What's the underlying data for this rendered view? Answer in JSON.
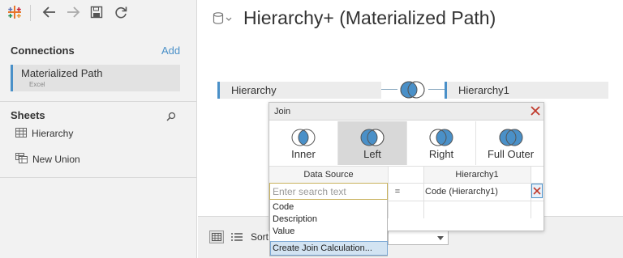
{
  "sidebar": {
    "connections_title": "Connections",
    "add_label": "Add",
    "connection": {
      "name": "Materialized Path",
      "type": "Excel"
    },
    "sheets_title": "Sheets",
    "sheets": [
      {
        "label": "Hierarchy",
        "icon": "table-icon"
      },
      {
        "label": "New Union",
        "icon": "union-icon"
      }
    ]
  },
  "header": {
    "title": "Hierarchy+ (Materialized Path)"
  },
  "canvas": {
    "left_table": "Hierarchy",
    "right_table": "Hierarchy1"
  },
  "join_dialog": {
    "title": "Join",
    "types": [
      {
        "label": "Inner",
        "selected": false
      },
      {
        "label": "Left",
        "selected": true
      },
      {
        "label": "Right",
        "selected": false
      },
      {
        "label": "Full Outer",
        "selected": false
      }
    ],
    "col_left": "Data Source",
    "col_right": "Hierarchy1",
    "operator": "=",
    "right_value": "Code (Hierarchy1)",
    "search_placeholder": "Enter search text",
    "options": [
      "Code",
      "Description",
      "Value"
    ],
    "create_calc": "Create Join Calculation..."
  },
  "bottom": {
    "sort_label": "Sort"
  },
  "colors": {
    "accent": "#4a90c8",
    "venn_fill": "#4a90c8",
    "close_red": "#c0392b"
  }
}
